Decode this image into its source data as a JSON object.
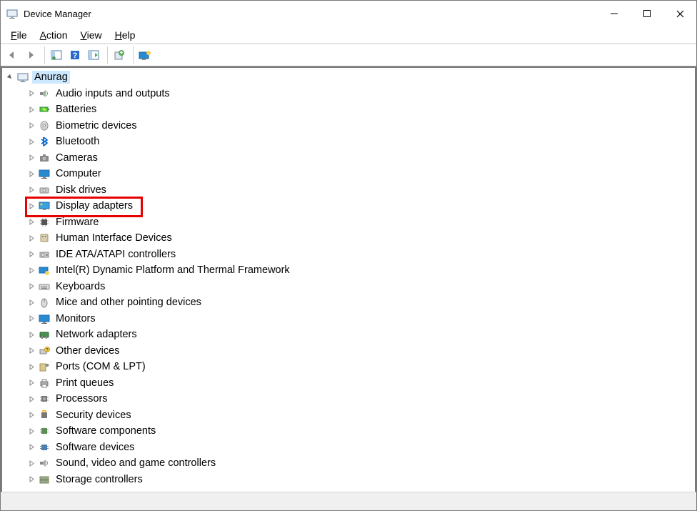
{
  "title": "Device Manager",
  "menu": {
    "file": "File",
    "action": "Action",
    "view": "View",
    "help": "Help"
  },
  "root": "Anurag",
  "highlight_index": 7,
  "categories": [
    {
      "label": "Audio inputs and outputs",
      "icon": "speaker"
    },
    {
      "label": "Batteries",
      "icon": "battery"
    },
    {
      "label": "Biometric devices",
      "icon": "fingerprint"
    },
    {
      "label": "Bluetooth",
      "icon": "bluetooth"
    },
    {
      "label": "Cameras",
      "icon": "camera"
    },
    {
      "label": "Computer",
      "icon": "monitor"
    },
    {
      "label": "Disk drives",
      "icon": "disk"
    },
    {
      "label": "Display adapters",
      "icon": "display"
    },
    {
      "label": "Firmware",
      "icon": "chip"
    },
    {
      "label": "Human Interface Devices",
      "icon": "hid"
    },
    {
      "label": "IDE ATA/ATAPI controllers",
      "icon": "ide"
    },
    {
      "label": "Intel(R) Dynamic Platform and Thermal Framework",
      "icon": "thermal"
    },
    {
      "label": "Keyboards",
      "icon": "keyboard"
    },
    {
      "label": "Mice and other pointing devices",
      "icon": "mouse"
    },
    {
      "label": "Monitors",
      "icon": "monitor2"
    },
    {
      "label": "Network adapters",
      "icon": "network"
    },
    {
      "label": "Other devices",
      "icon": "other"
    },
    {
      "label": "Ports (COM & LPT)",
      "icon": "port"
    },
    {
      "label": "Print queues",
      "icon": "printer"
    },
    {
      "label": "Processors",
      "icon": "cpu"
    },
    {
      "label": "Security devices",
      "icon": "security"
    },
    {
      "label": "Software components",
      "icon": "swcomp"
    },
    {
      "label": "Software devices",
      "icon": "swdev"
    },
    {
      "label": "Sound, video and game controllers",
      "icon": "sound"
    },
    {
      "label": "Storage controllers",
      "icon": "storage"
    }
  ]
}
